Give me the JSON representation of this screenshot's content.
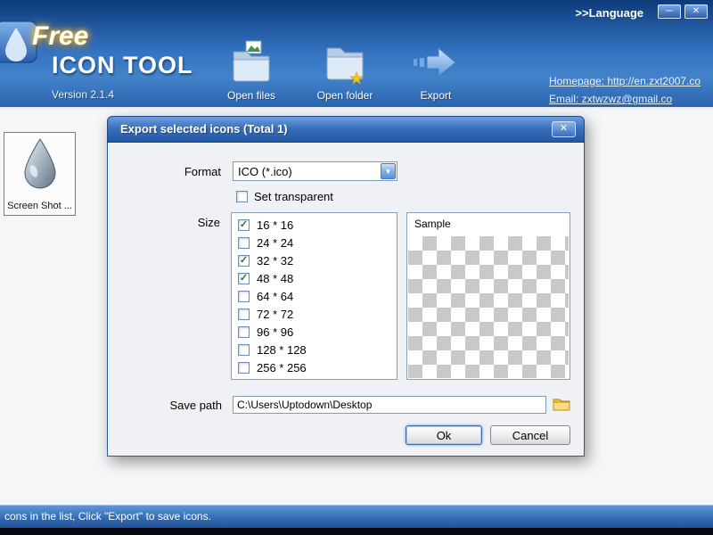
{
  "window": {
    "language_label": ">>Language",
    "minimize_glyph": "─",
    "close_glyph": "✕"
  },
  "header": {
    "logo_free": "Free",
    "logo_icon_tool": "ICON TOOL",
    "version": "Version 2.1.4",
    "toolbar": [
      {
        "label": "Open files"
      },
      {
        "label": "Open folder"
      },
      {
        "label": "Export"
      }
    ],
    "links": {
      "homepage": "Homepage: http://en.zxt2007.co",
      "email": "Email: zxtwzwz@gmail.co"
    }
  },
  "sidebar": {
    "thumbnail_label": "Screen Shot ..."
  },
  "dialog": {
    "title": "Export selected icons (Total 1)",
    "close_glyph": "✕",
    "format_label": "Format",
    "format_value": "ICO (*.ico)",
    "transparent_label": "Set transparent",
    "transparent_checked": false,
    "size_label": "Size",
    "sizes": [
      {
        "label": "16 * 16",
        "checked": true
      },
      {
        "label": "24 * 24",
        "checked": false
      },
      {
        "label": "32 * 32",
        "checked": true
      },
      {
        "label": "48 * 48",
        "checked": true
      },
      {
        "label": "64 * 64",
        "checked": false
      },
      {
        "label": "72 * 72",
        "checked": false
      },
      {
        "label": "96 * 96",
        "checked": false
      },
      {
        "label": "128 * 128",
        "checked": false
      },
      {
        "label": "256 * 256",
        "checked": false
      }
    ],
    "sample_label": "Sample",
    "save_path_label": "Save path",
    "save_path_value": "C:\\Users\\Uptodown\\Desktop",
    "ok_label": "Ok",
    "cancel_label": "Cancel"
  },
  "statusbar": {
    "text": "cons in the list, Click \"Export\" to save icons."
  },
  "colors": {
    "header_blue": "#3574c2",
    "title_bar_blue": "#2257a2",
    "dialog_body": "#f0f1f4",
    "check_green": "#1f7a1f"
  }
}
